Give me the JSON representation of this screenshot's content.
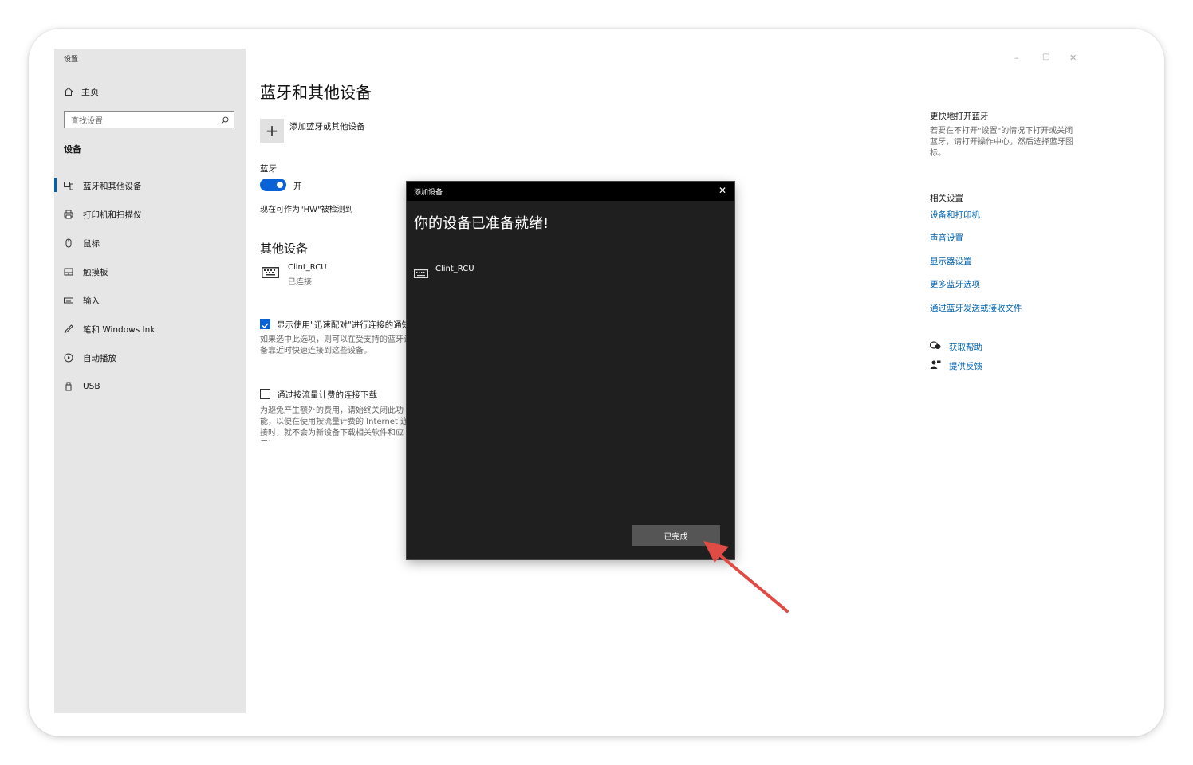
{
  "app": {
    "title": "设置"
  },
  "sidebar": {
    "home_label": "主页",
    "search_placeholder": "查找设置",
    "section": "设备",
    "items": [
      {
        "label": "蓝牙和其他设备",
        "icon": "bluetooth-devices-icon",
        "active": true
      },
      {
        "label": "打印机和扫描仪",
        "icon": "printer-icon"
      },
      {
        "label": "鼠标",
        "icon": "mouse-icon"
      },
      {
        "label": "触摸板",
        "icon": "touchpad-icon"
      },
      {
        "label": "输入",
        "icon": "keyboard-icon"
      },
      {
        "label": "笔和 Windows Ink",
        "icon": "pen-icon"
      },
      {
        "label": "自动播放",
        "icon": "autoplay-icon"
      },
      {
        "label": "USB",
        "icon": "usb-icon"
      }
    ]
  },
  "main": {
    "title": "蓝牙和其他设备",
    "add_device_label": "添加蓝牙或其他设备",
    "bluetooth_label": "蓝牙",
    "bluetooth_state": "开",
    "discoverable_text": "现在可作为\"HW\"被检测到",
    "other_devices_title": "其他设备",
    "device": {
      "name": "Clint_RCU",
      "status": "已连接"
    },
    "swift_pair": {
      "label": "显示使用\"迅速配对\"进行连接的通知",
      "checked": true,
      "description": "如果选中此选项，则可以在受支持的蓝牙设备靠近时快速连接到这些设备。"
    },
    "metered": {
      "label": "通过按流量计费的连接下载",
      "checked": false,
      "description": "为避免产生额外的费用，请始终关闭此功能，以便在使用按流量计费的 Internet 连接时，就不会为新设备下载相关软件和应用)。"
    }
  },
  "window_controls": {
    "minimize": "–",
    "maximize": "▢",
    "close": "✕"
  },
  "right": {
    "quick_title": "更快地打开蓝牙",
    "quick_desc": "若要在不打开\"设置\"的情况下打开或关闭蓝牙，请打开操作中心，然后选择蓝牙图标。",
    "related_title": "相关设置",
    "links": [
      "设备和打印机",
      "声音设置",
      "显示器设置",
      "更多蓝牙选项",
      "通过蓝牙发送或接收文件"
    ],
    "help": "获取帮助",
    "feedback": "提供反馈"
  },
  "dialog": {
    "title": "添加设备",
    "close": "✕",
    "heading": "你的设备已准备就绪!",
    "device_name": "Clint_RCU",
    "done_button": "已完成"
  },
  "colors": {
    "accent": "#0a63d6",
    "link": "#0063b1",
    "arrow": "#e04b45"
  }
}
